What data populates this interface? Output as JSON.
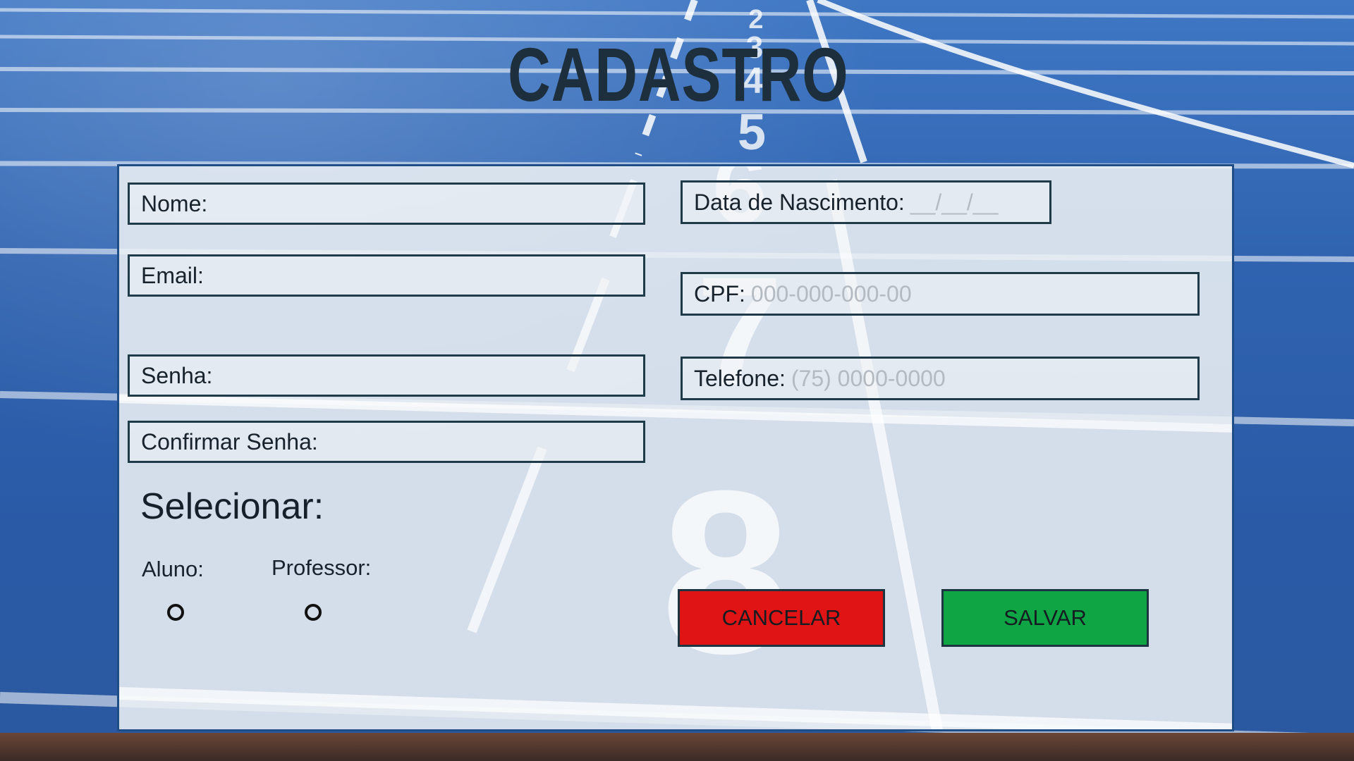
{
  "page": {
    "title": "CADASTRO"
  },
  "background": {
    "lane_numbers": [
      "2",
      "3",
      "4",
      "5"
    ],
    "panel_numbers": [
      "6",
      "7",
      "8"
    ],
    "colors": {
      "track": "#2a5aa6",
      "lines": "#ffffff"
    }
  },
  "form": {
    "fields": {
      "nome": {
        "label": "Nome:",
        "value": "",
        "placeholder": ""
      },
      "data_nascimento": {
        "label": "Data de Nascimento:",
        "value": "",
        "placeholder": "__/__/__"
      },
      "email": {
        "label": "Email:",
        "value": "",
        "placeholder": ""
      },
      "cpf": {
        "label": "CPF:",
        "value": "",
        "placeholder": "000-000-000-00"
      },
      "senha": {
        "label": "Senha:",
        "value": "",
        "placeholder": ""
      },
      "telefone": {
        "label": "Telefone:",
        "value": "",
        "placeholder": "(75) 0000-0000"
      },
      "confirmar_senha": {
        "label": "Confirmar Senha:",
        "value": "",
        "placeholder": ""
      }
    },
    "selection": {
      "title": "Selecionar:",
      "options": [
        {
          "label": "Aluno:",
          "selected": false
        },
        {
          "label": "Professor:",
          "selected": false
        }
      ]
    },
    "buttons": {
      "cancel": {
        "label": "CANCELAR",
        "color": "#e01414"
      },
      "save": {
        "label": "SALVAR",
        "color": "#0fa544"
      }
    }
  }
}
